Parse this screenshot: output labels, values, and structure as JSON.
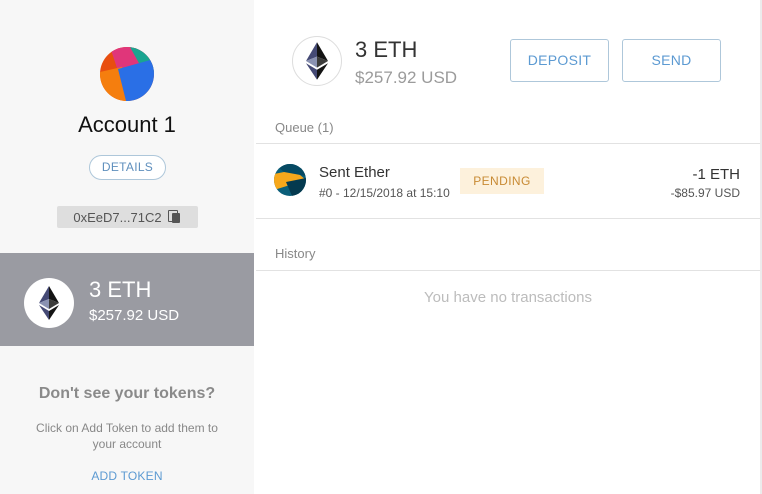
{
  "account": {
    "name": "Account 1",
    "details_label": "DETAILS",
    "address": "0xEeD7...71C2"
  },
  "sidebar_balance": {
    "eth": "3 ETH",
    "usd": "$257.92 USD"
  },
  "tokens_prompt": {
    "heading": "Don't see your tokens?",
    "text": "Click on Add Token to add them to your account",
    "add_token_label": "ADD TOKEN"
  },
  "main_balance": {
    "eth": "3 ETH",
    "usd": "$257.92 USD"
  },
  "actions": {
    "deposit_label": "DEPOSIT",
    "send_label": "SEND"
  },
  "queue": {
    "label": "Queue (1)",
    "items": [
      {
        "title": "Sent Ether",
        "subtitle": "#0 - 12/15/2018 at 15:10",
        "status": "PENDING",
        "eth_amount": "-1 ETH",
        "usd_amount": "-$85.97 USD"
      }
    ]
  },
  "history": {
    "label": "History",
    "empty_message": "You have no transactions"
  },
  "icons": {
    "eth_logo": "ethereum-icon",
    "copy": "copy-icon"
  },
  "colors": {
    "accent_blue": "#5c9ad2",
    "pending_bg": "#fdf1dc",
    "pending_text": "#c88a33",
    "sidebar_card": "#9a9ba2"
  }
}
